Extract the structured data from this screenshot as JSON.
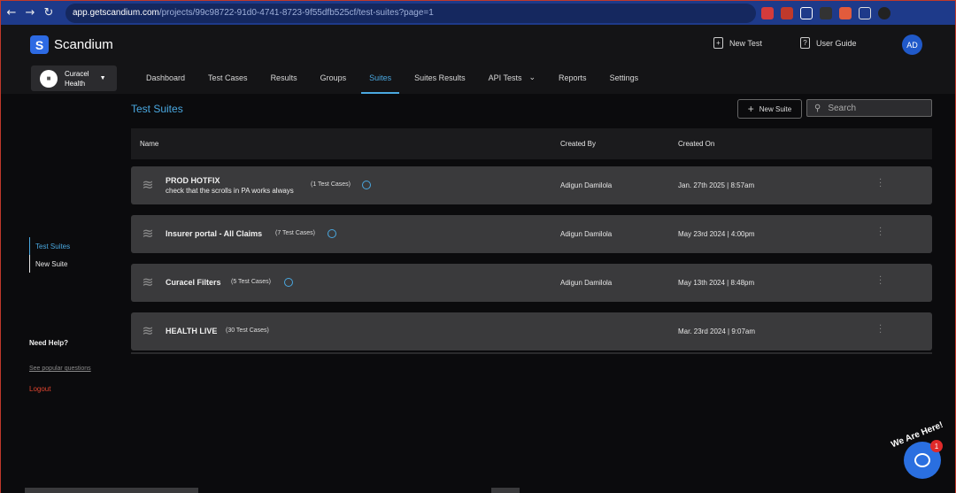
{
  "browser": {
    "back": "←",
    "forward": "→",
    "reload": "↻",
    "url_host": "app.getscandium.com",
    "url_path": "/projects/99c98722-91d0-4741-8723-9f55dfb525cf/test-suites?page=1"
  },
  "header": {
    "brand": "Scandium",
    "logo_letter": "S",
    "new_test": "New Test",
    "user_guide": "User Guide",
    "avatar": "AD",
    "org_line1": "Curacel",
    "org_line2": "Health"
  },
  "tabs": [
    {
      "label": "Dashboard"
    },
    {
      "label": "Test Cases"
    },
    {
      "label": "Results"
    },
    {
      "label": "Groups"
    },
    {
      "label": "Suites"
    },
    {
      "label": "Suites Results"
    },
    {
      "label": "API Tests"
    },
    {
      "label": "Reports"
    },
    {
      "label": "Settings"
    }
  ],
  "sidebar": {
    "items": [
      {
        "label": "Test Suites"
      },
      {
        "label": "New Suite"
      }
    ],
    "help": "Need Help?",
    "faq": "See popular questions",
    "logout": "Logout"
  },
  "page": {
    "title": "Test Suites",
    "new_suite": "New Suite",
    "search_placeholder": "Search"
  },
  "table": {
    "columns": {
      "name": "Name",
      "created_by": "Created By",
      "created_on": "Created On"
    },
    "rows": [
      {
        "name": "PROD HOTFIX",
        "desc": "check that the scrolls in PA works always",
        "count": "(1 Test Cases)",
        "by": "Adigun Damilola",
        "on": "Jan. 27th 2025 | 8:57am"
      },
      {
        "name": "Insurer portal - All Claims",
        "desc": "",
        "count": "(7 Test Cases)",
        "by": "Adigun Damilola",
        "on": "May 23rd 2024 | 4:00pm"
      },
      {
        "name": "Curacel Filters",
        "desc": "",
        "count": "(5 Test Cases)",
        "by": "Adigun Damilola",
        "on": "May 13th 2024 | 8:48pm"
      },
      {
        "name": "HEALTH LIVE",
        "desc": "",
        "count": "(30 Test Cases)",
        "by": "",
        "on": "Mar. 23rd 2024 | 9:07am"
      }
    ]
  },
  "chat": {
    "tag": "We Are Here!",
    "badge": "1"
  },
  "colors": {
    "accent": "#4aa8e0",
    "brand": "#2d6ae3",
    "logout": "#e0452f",
    "row_bg": "#3a3a3c"
  }
}
